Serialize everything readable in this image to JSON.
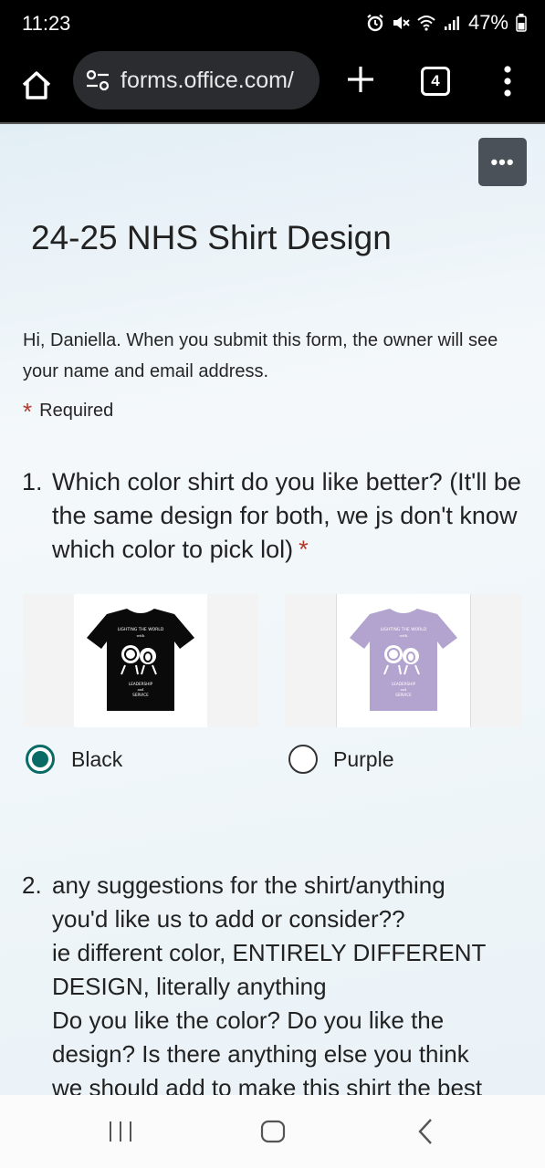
{
  "status_bar": {
    "time": "11:23",
    "battery": "47%"
  },
  "browser": {
    "url": "forms.office.com/",
    "tab_count": "4"
  },
  "form": {
    "menu_label": "•••",
    "title": "24-25 NHS Shirt Design",
    "info": "Hi, Daniella. When you submit this form, the owner will see your name and email address.",
    "required_star": "*",
    "required_label": "Required"
  },
  "question1": {
    "number": "1.",
    "text": "Which color shirt do you like better? (It'll be the same design for both, we js don't know which color to pick lol)",
    "required_star": "*",
    "options": [
      {
        "label": "Black",
        "selected": true,
        "shirt_color": "#0a0a0a"
      },
      {
        "label": "Purple",
        "selected": false,
        "shirt_color": "#b3a3cf"
      }
    ],
    "shirt_texts": {
      "top": "LIGHTING THE WORLD",
      "sub": "with",
      "bottom1": "LEADERSHIP",
      "bottom2": "and",
      "bottom3": "SERVICE"
    }
  },
  "question2": {
    "number": "2.",
    "lines": [
      "any suggestions for the shirt/anything",
      "you'd like us to add or consider??",
      "ie different color, ENTIRELY DIFFERENT",
      "DESIGN, literally anything",
      "Do you like the color? Do you like the",
      "design? Is there anything else you think",
      "we should add to make this shirt the best"
    ]
  },
  "colors": {
    "accent": "#0a6b66",
    "required": "#b23a2a"
  }
}
